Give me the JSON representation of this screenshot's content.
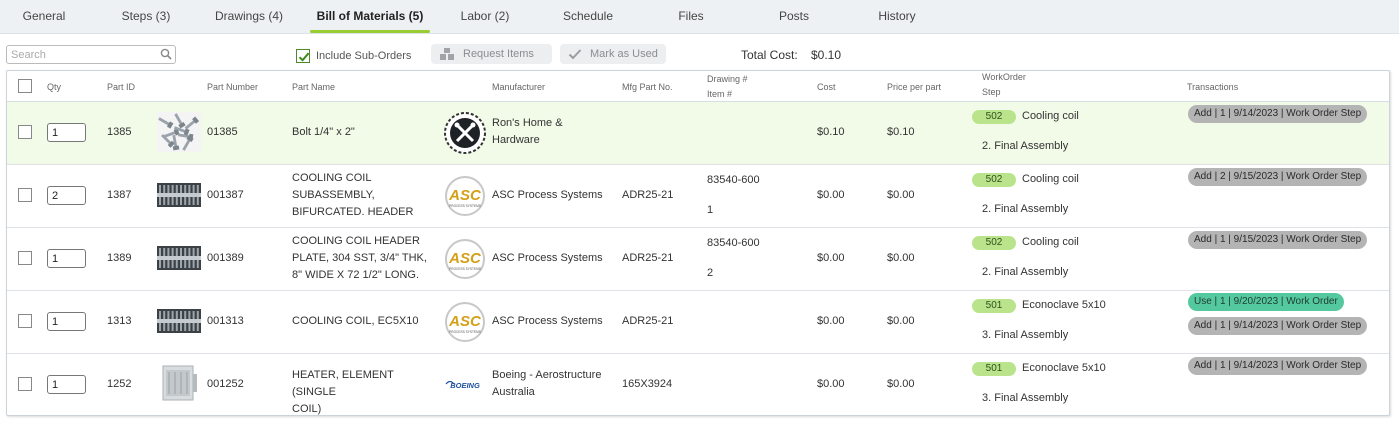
{
  "tabs": [
    {
      "label": "General"
    },
    {
      "label": "Steps (3)"
    },
    {
      "label": "Drawings (4)"
    },
    {
      "label": "Bill of Materials (5)",
      "active": true
    },
    {
      "label": "Labor (2)"
    },
    {
      "label": "Schedule"
    },
    {
      "label": "Files"
    },
    {
      "label": "Posts"
    },
    {
      "label": "History"
    }
  ],
  "toolbar": {
    "search_placeholder": "Search",
    "include_sub_orders_label": "Include Sub-Orders",
    "include_sub_orders_checked": true,
    "request_items_label": "Request Items",
    "mark_as_used_label": "Mark as Used",
    "total_cost_label": "Total Cost:",
    "total_cost_value": "$0.10"
  },
  "columns": {
    "qty": "Qty",
    "part_id": "Part ID",
    "part_number": "Part Number",
    "part_name": "Part Name",
    "manufacturer": "Manufacturer",
    "mfg_part_no": "Mfg Part No.",
    "drawing": "Drawing #",
    "item": "Item #",
    "cost": "Cost",
    "price_per_part": "Price per part",
    "workorder": "WorkOrder",
    "step": "Step",
    "transactions": "Transactions"
  },
  "rows": [
    {
      "qty": "1",
      "part_id": "1385",
      "thumb": "bolts-image",
      "part_number": "01385",
      "part_name": [
        "Bolt 1/4\" x 2\""
      ],
      "logo": "rons-hardware-logo",
      "manufacturer": [
        "Ron's Home &",
        "Hardware"
      ],
      "mfg_part_no": "",
      "drawing": "",
      "item": "",
      "cost": "$0.10",
      "price": "$0.10",
      "wo": "502",
      "wo_name": "Cooling coil",
      "step": "2. Final Assembly",
      "transactions": [
        {
          "label": "Add | 1 | 9/14/2023 | Work Order Step",
          "type": "add"
        }
      ],
      "selected": true
    },
    {
      "qty": "2",
      "part_id": "1387",
      "thumb": "coil-image",
      "part_number": "001387",
      "part_name": [
        "COOLING COIL",
        "SUBASSEMBLY,",
        "BIFURCATED. HEADER"
      ],
      "logo": "asc-logo",
      "manufacturer": [
        "ASC Process Systems"
      ],
      "mfg_part_no": "ADR25-21",
      "drawing": "83540-600",
      "item": "1",
      "cost": "$0.00",
      "price": "$0.00",
      "wo": "502",
      "wo_name": "Cooling coil",
      "step": "2. Final Assembly",
      "transactions": [
        {
          "label": "Add | 2 | 9/15/2023 | Work Order Step",
          "type": "add"
        }
      ],
      "selected": false
    },
    {
      "qty": "1",
      "part_id": "1389",
      "thumb": "coil-image",
      "part_number": "001389",
      "part_name": [
        "COOLING COIL HEADER",
        "PLATE, 304 SST, 3/4\" THK,",
        "8\" WIDE X 72 1/2\" LONG."
      ],
      "logo": "asc-logo",
      "manufacturer": [
        "ASC Process Systems"
      ],
      "mfg_part_no": "ADR25-21",
      "drawing": "83540-600",
      "item": "2",
      "cost": "$0.00",
      "price": "$0.00",
      "wo": "502",
      "wo_name": "Cooling coil",
      "step": "2. Final Assembly",
      "transactions": [
        {
          "label": "Add | 1 | 9/15/2023 | Work Order Step",
          "type": "add"
        }
      ],
      "selected": false
    },
    {
      "qty": "1",
      "part_id": "1313",
      "thumb": "coil-image",
      "part_number": "001313",
      "part_name": [
        "COOLING COIL, EC5X10"
      ],
      "logo": "asc-logo",
      "manufacturer": [
        "ASC Process Systems"
      ],
      "mfg_part_no": "ADR25-21",
      "drawing": "",
      "item": "",
      "cost": "$0.00",
      "price": "$0.00",
      "wo": "501",
      "wo_name": "Econoclave 5x10",
      "step": "3. Final Assembly",
      "transactions": [
        {
          "label": "Use | 1 | 9/20/2023 | Work Order",
          "type": "use"
        },
        {
          "label": "Add | 1 | 9/14/2023 | Work Order Step",
          "type": "add"
        }
      ],
      "selected": false
    },
    {
      "qty": "1",
      "part_id": "1252",
      "thumb": "heater-image",
      "part_number": "001252",
      "part_name": [
        "HEATER, ELEMENT (SINGLE",
        "COIL)"
      ],
      "logo": "boeing-logo",
      "manufacturer": [
        "Boeing - Aerostructure",
        "Australia"
      ],
      "mfg_part_no": "165X3924",
      "drawing": "",
      "item": "",
      "cost": "$0.00",
      "price": "$0.00",
      "wo": "501",
      "wo_name": "Econoclave 5x10",
      "step": "3. Final Assembly",
      "transactions": [
        {
          "label": "Add | 1 | 9/14/2023 | Work Order Step",
          "type": "add"
        }
      ],
      "selected": false
    }
  ],
  "logo_text": {
    "asc": "ASC",
    "asc_sub": "PROCESS SYSTEMS",
    "boeing": "BOEING"
  },
  "colors": {
    "accent": "#9acd32",
    "selected_row": "#f2fae8",
    "wo_badge": "#b9e48c",
    "tx_add": "#b4b4b4",
    "tx_use": "#54c9a0",
    "asc_gold": "#d4a017"
  }
}
